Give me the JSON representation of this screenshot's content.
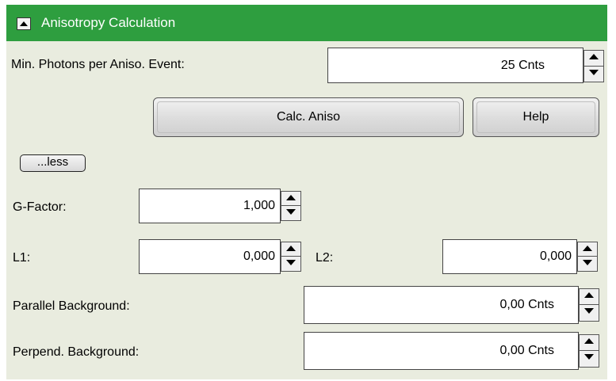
{
  "header": {
    "title": "Anisotropy Calculation"
  },
  "min_photons": {
    "label": "Min. Photons per Aniso. Event:",
    "value": "25 Cnts"
  },
  "buttons": {
    "calc": "Calc. Aniso",
    "help": "Help",
    "less": "...less"
  },
  "g_factor": {
    "label": "G-Factor:",
    "value": "1,000"
  },
  "l1": {
    "label": "L1:",
    "value": "0,000"
  },
  "l2": {
    "label": "L2:",
    "value": "0,000"
  },
  "parallel_bg": {
    "label": "Parallel Background:",
    "value": "0,00 Cnts"
  },
  "perpend_bg": {
    "label": "Perpend. Background:",
    "value": "0,00 Cnts"
  },
  "colors": {
    "header": "#2e9e3f",
    "panel": "#e9ecdf"
  }
}
